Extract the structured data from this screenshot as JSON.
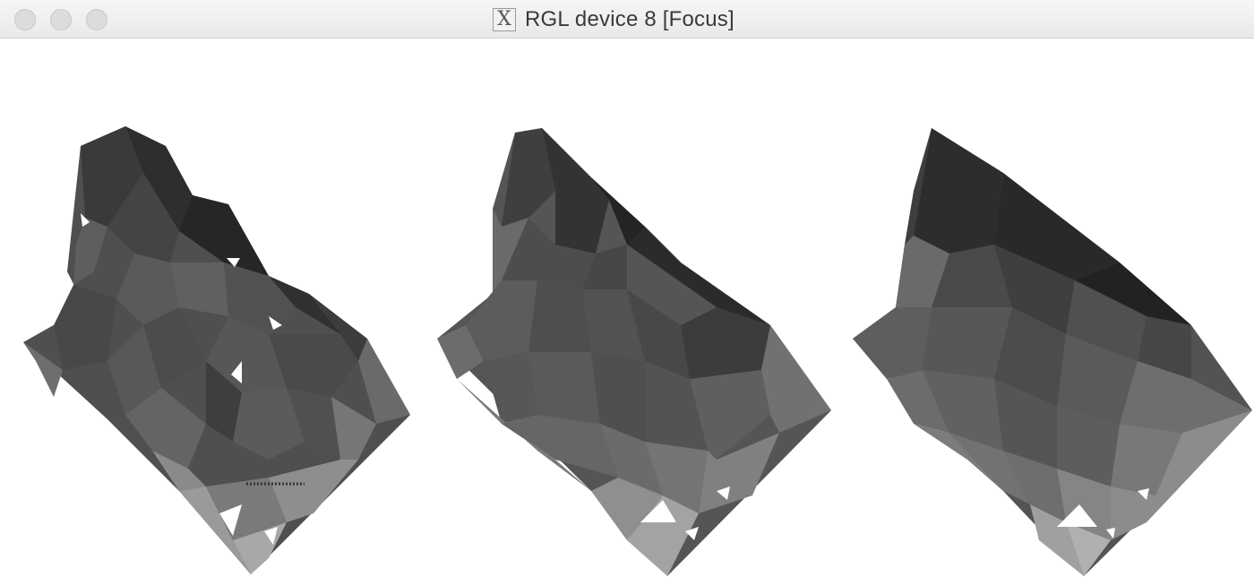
{
  "window": {
    "title": "RGL device 8 [Focus]",
    "title_icon": "x11-icon",
    "controls": [
      "close",
      "minimize",
      "zoom"
    ]
  },
  "scene": {
    "description_type": "three triangulated 3D surfaces",
    "surfaces": [
      {
        "name": "surface-high-detail"
      },
      {
        "name": "surface-medium-detail"
      },
      {
        "name": "surface-low-detail"
      }
    ],
    "colors": {
      "background": "#ffffff",
      "dark": "#2a2a2a",
      "mid": "#565656",
      "light": "#8c8c8c",
      "pale": "#b8b8b8"
    }
  }
}
